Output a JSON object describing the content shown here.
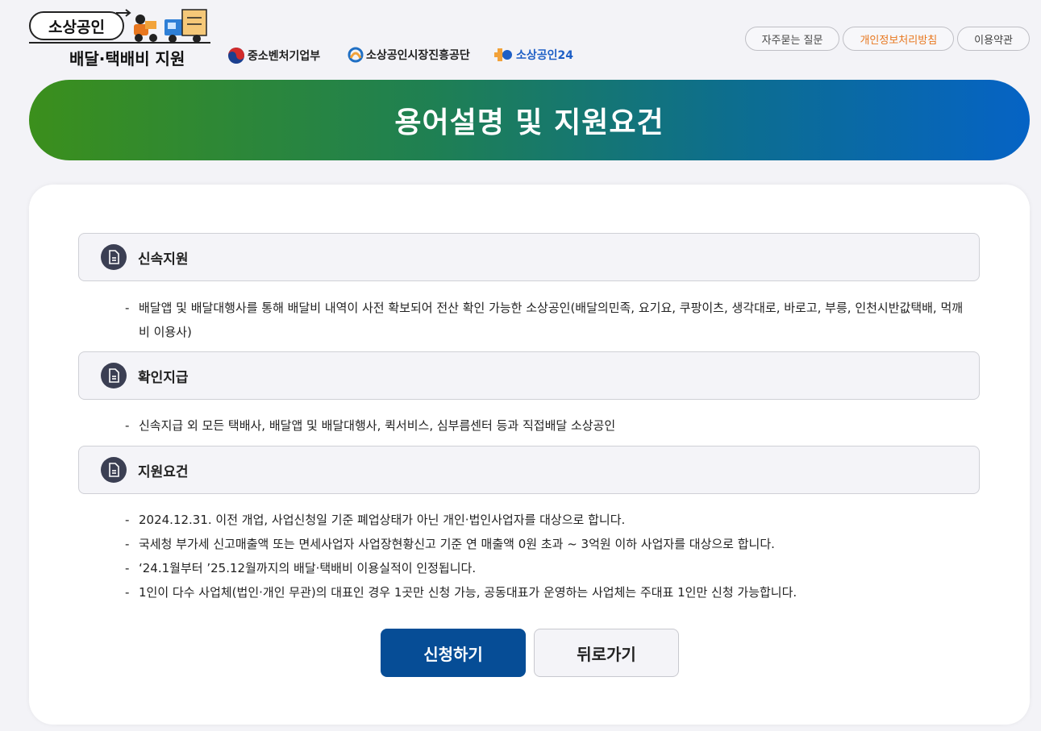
{
  "logo": {
    "top_label": "소상공인",
    "sub_label": "배달·택배비 지원"
  },
  "orgs": [
    {
      "label": "중소벤처기업부"
    },
    {
      "label": "소상공인시장진흥공단"
    },
    {
      "label": "소상공인24"
    }
  ],
  "top_links": {
    "faq": "자주묻는 질문",
    "privacy": "개인정보처리방침",
    "terms": "이용약관"
  },
  "colors": {
    "banner_start": "#3b8f1c",
    "banner_end": "#0563c5",
    "apply_button": "#064d96",
    "privacy_link": "#e8771f"
  },
  "banner": {
    "title": "용어설명 및 지원요건"
  },
  "sections": [
    {
      "title": "신속지원",
      "icon": "document-icon",
      "items": [
        "배달앱 및 배달대행사를 통해 배달비 내역이 사전 확보되어 전산 확인 가능한 소상공인(배달의민족, 요기요, 쿠팡이츠, 생각대로, 바로고, 부릉, 인천시반값택배, 먹깨비 이용사)"
      ]
    },
    {
      "title": "확인지급",
      "icon": "document-icon",
      "items": [
        "신속지급 외 모든 택배사, 배달앱 및 배달대행사, 퀵서비스, 심부름센터 등과 직접배달 소상공인"
      ]
    },
    {
      "title": "지원요건",
      "icon": "document-icon",
      "items": [
        "2024.12.31. 이전 개업, 사업신청일 기준 폐업상태가 아닌 개인·법인사업자를 대상으로 합니다.",
        "국세청 부가세 신고매출액 또는 면세사업자 사업장현황신고 기준 연 매출액 0원 초과 ~ 3억원 이하 사업자를 대상으로 합니다.",
        "‘24.1월부터 ’25.12월까지의 배달·택배비 이용실적이 인정됩니다.",
        "1인이 다수 사업체(법인·개인 무관)의 대표인 경우 1곳만 신청 가능, 공동대표가 운영하는 사업체는 주대표 1인만 신청 가능합니다."
      ]
    }
  ],
  "item_dash": "-",
  "buttons": {
    "apply": "신청하기",
    "back": "뒤로가기"
  }
}
